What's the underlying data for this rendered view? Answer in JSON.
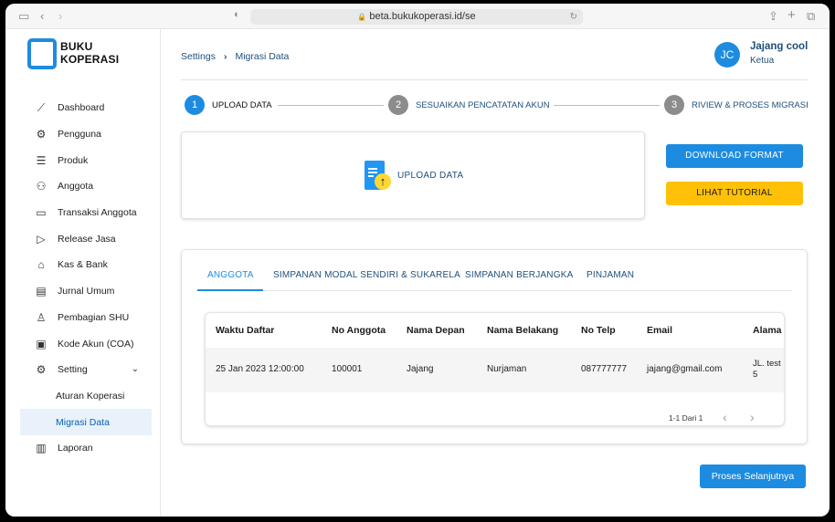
{
  "browser": {
    "url": "beta.bukukoperasi.id/se",
    "icons": [
      "sidebar-toggle-icon",
      "back-icon",
      "forward-icon",
      "shield-icon",
      "lock-icon",
      "reload-icon",
      "share-icon",
      "new-tab-icon",
      "tabs-overview-icon"
    ]
  },
  "logo": {
    "line1": "BUKU",
    "line2": "KOPERASI"
  },
  "sidebar": {
    "items": [
      {
        "label": "Dashboard",
        "icon": "chart-line-icon"
      },
      {
        "label": "Pengguna",
        "icon": "user-gear-icon"
      },
      {
        "label": "Produk",
        "icon": "list-icon"
      },
      {
        "label": "Anggota",
        "icon": "users-icon"
      },
      {
        "label": "Transaksi Anggota",
        "icon": "card-icon"
      },
      {
        "label": "Release Jasa",
        "icon": "send-icon"
      },
      {
        "label": "Kas & Bank",
        "icon": "bank-icon"
      },
      {
        "label": "Jurnal Umum",
        "icon": "book-icon"
      },
      {
        "label": "Pembagian SHU",
        "icon": "user-share-icon"
      },
      {
        "label": "Kode Akun (COA)",
        "icon": "clipboard-icon"
      },
      {
        "label": "Setting",
        "icon": "gear-icon"
      },
      {
        "label": "Aturan Koperasi"
      },
      {
        "label": "Migrasi Data"
      },
      {
        "label": "Laporan",
        "icon": "report-icon"
      }
    ]
  },
  "breadcrumb": {
    "parent": "Settings",
    "current": "Migrasi Data"
  },
  "user": {
    "initials": "JC",
    "name": "Jajang cool",
    "role": "Ketua"
  },
  "steps": [
    {
      "num": "1",
      "label": "UPLOAD DATA"
    },
    {
      "num": "2",
      "label": "SESUAIKAN PENCATATAN AKUN"
    },
    {
      "num": "3",
      "label": "RIVIEW & PROSES MIGRASI"
    }
  ],
  "upload": {
    "label": "UPLOAD DATA"
  },
  "buttons": {
    "download": "DOWNLOAD FORMAT",
    "tutorial": "LIHAT TUTORIAL",
    "next": "Proses Selanjutnya"
  },
  "tabs": [
    "ANGGOTA",
    "SIMPANAN MODAL SENDIRI & SUKARELA",
    "SIMPANAN BERJANGKA",
    "PINJAMAN"
  ],
  "table": {
    "headers": [
      "Waktu Daftar",
      "No Anggota",
      "Nama Depan",
      "Nama Belakang",
      "No Telp",
      "Email",
      "Alama"
    ],
    "rows": [
      [
        "25 Jan 2023 12:00:00",
        "100001",
        "Jajang",
        "Nurjaman",
        "087777777",
        "jajang@gmail.com",
        "JL. test",
        "5"
      ]
    ],
    "pagination": "1-1 Dari 1"
  },
  "colors": {
    "primary": "#1d8ce0",
    "accent": "#ffc107",
    "text": "#1e4f7a"
  }
}
